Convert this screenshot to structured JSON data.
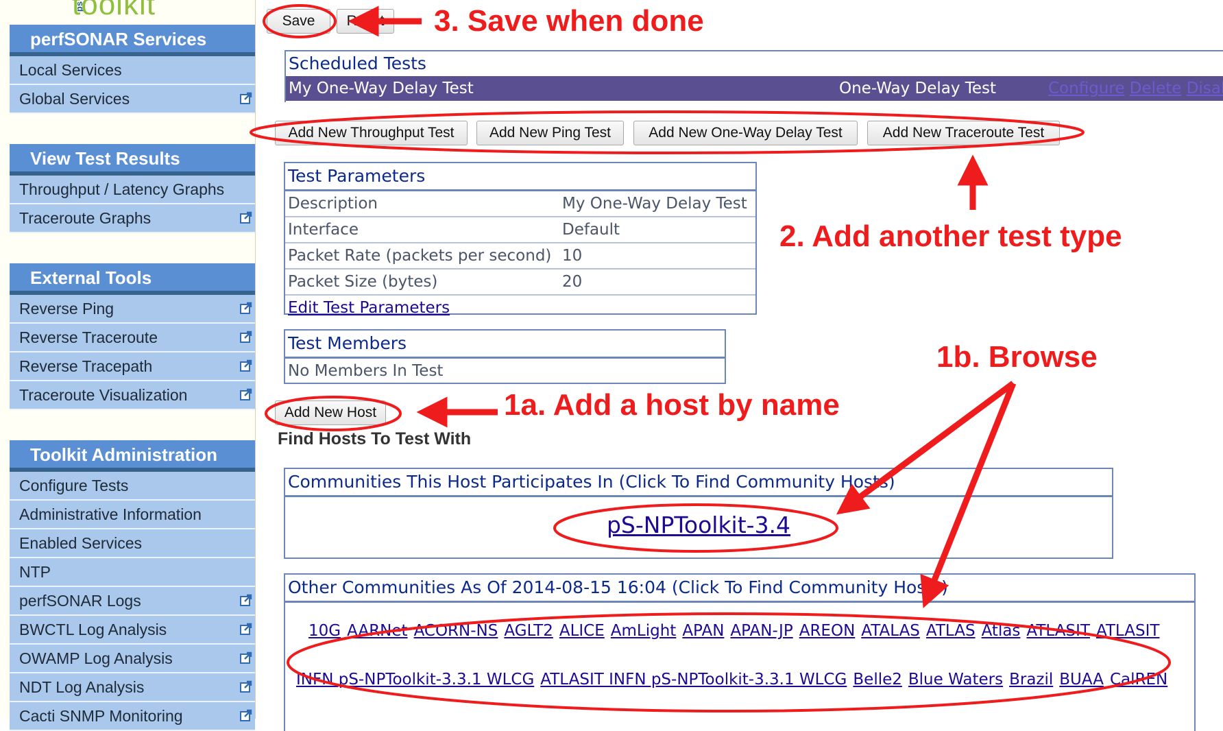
{
  "brand": {
    "logo_text": "toolkit",
    "logo_prefix": "ps"
  },
  "sidebar": {
    "sections": [
      {
        "title": "perfSONAR Services",
        "items": [
          {
            "label": "Local Services",
            "external": false
          },
          {
            "label": "Global Services",
            "external": true
          }
        ]
      },
      {
        "title": "View Test Results",
        "items": [
          {
            "label": "Throughput / Latency Graphs",
            "external": false
          },
          {
            "label": "Traceroute Graphs",
            "external": true
          }
        ]
      },
      {
        "title": "External Tools",
        "items": [
          {
            "label": "Reverse Ping",
            "external": true
          },
          {
            "label": "Reverse Traceroute",
            "external": true
          },
          {
            "label": "Reverse Tracepath",
            "external": true
          },
          {
            "label": "Traceroute Visualization",
            "external": true
          }
        ]
      },
      {
        "title": "Toolkit Administration",
        "items": [
          {
            "label": "Configure Tests",
            "external": false
          },
          {
            "label": "Administrative Information",
            "external": false
          },
          {
            "label": "Enabled Services",
            "external": false
          },
          {
            "label": "NTP",
            "external": false
          },
          {
            "label": "perfSONAR Logs",
            "external": true
          },
          {
            "label": "BWCTL Log Analysis",
            "external": true
          },
          {
            "label": "OWAMP Log Analysis",
            "external": true
          },
          {
            "label": "NDT Log Analysis",
            "external": true
          },
          {
            "label": "Cacti SNMP Monitoring",
            "external": true
          }
        ]
      }
    ]
  },
  "toolbar": {
    "save_label": "Save",
    "reset_label": "Reset"
  },
  "scheduled_tests": {
    "title": "Scheduled Tests",
    "rows": [
      {
        "name": "My One-Way Delay Test",
        "type": "One-Way Delay Test",
        "actions": [
          "Configure",
          "Delete",
          "Disable"
        ]
      }
    ]
  },
  "add_test_buttons": [
    "Add New Throughput Test",
    "Add New Ping Test",
    "Add New One-Way Delay Test",
    "Add New Traceroute Test"
  ],
  "test_parameters": {
    "title": "Test Parameters",
    "rows": [
      {
        "label": "Description",
        "value": "My One-Way Delay Test"
      },
      {
        "label": "Interface",
        "value": "Default"
      },
      {
        "label": "Packet Rate (packets per second)",
        "value": "10"
      },
      {
        "label": "Packet Size (bytes)",
        "value": "20"
      }
    ],
    "edit_link": "Edit Test Parameters"
  },
  "test_members": {
    "title": "Test Members",
    "empty_text": "No Members In Test"
  },
  "add_host_label": "Add New Host",
  "find_hosts_heading": "Find Hosts To Test With",
  "host_communities": {
    "title": "Communities This Host Participates In (Click To Find Community Hosts)",
    "items": [
      "pS-NPToolkit-3.4"
    ]
  },
  "other_communities": {
    "title": "Other Communities As Of 2014-08-15 16:04 (Click To Find Community Hosts)",
    "line1": [
      "10G",
      "AARNet",
      "ACORN-NS",
      "AGLT2",
      "ALICE",
      "AmLight",
      "APAN",
      "APAN-JP",
      "AREON",
      "ATALAS",
      "ATLAS",
      "Atlas",
      "ATLASIT",
      "ATLASIT"
    ],
    "line2": [
      "INFN pS-NPToolkit-3.3.1 WLCG",
      "ATLASIT INFN pS-NPToolkit-3.3.1 WLCG",
      "Belle2",
      "Blue Waters",
      "Brazil",
      "BUAA",
      "CalREN"
    ]
  },
  "annotations": {
    "step3": "3. Save when done",
    "step2": "2. Add another test type",
    "step1a": "1a. Add a host by name",
    "step1b": "1b. Browse"
  },
  "colors": {
    "annotation": "#ee1c1c",
    "sidebar_header": "#5b8fd4",
    "sidebar_item": "#a9c8eb",
    "selected_row": "#5a4f91",
    "link": "#1c0a94"
  }
}
